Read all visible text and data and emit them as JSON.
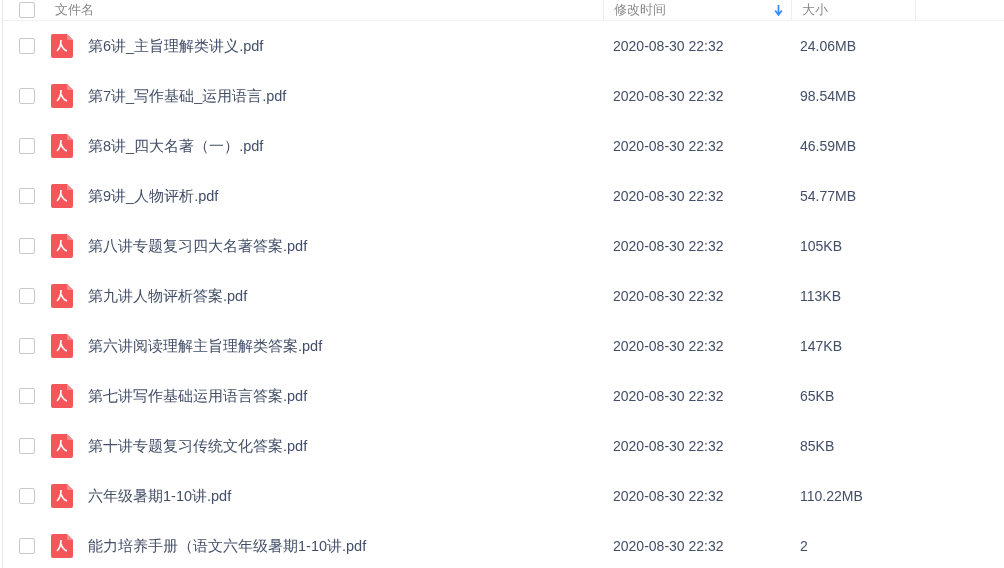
{
  "table": {
    "select_all_checked": false,
    "columns": [
      {
        "label": "文件名"
      },
      {
        "label": "修改时间",
        "sorted": true
      },
      {
        "label": "大小"
      }
    ],
    "rows": [
      {
        "name": "第6讲_主旨理解类讲义.pdf",
        "modified": "2020-08-30 22:32",
        "size": "24.06MB",
        "checked": false
      },
      {
        "name": "第7讲_写作基础_运用语言.pdf",
        "modified": "2020-08-30 22:32",
        "size": "98.54MB",
        "checked": false
      },
      {
        "name": "第8讲_四大名著（一）.pdf",
        "modified": "2020-08-30 22:32",
        "size": "46.59MB",
        "checked": false
      },
      {
        "name": "第9讲_人物评析.pdf",
        "modified": "2020-08-30 22:32",
        "size": "54.77MB",
        "checked": false
      },
      {
        "name": "第八讲专题复习四大名著答案.pdf",
        "modified": "2020-08-30 22:32",
        "size": "105KB",
        "checked": false
      },
      {
        "name": "第九讲人物评析答案.pdf",
        "modified": "2020-08-30 22:32",
        "size": "113KB",
        "checked": false
      },
      {
        "name": "第六讲阅读理解主旨理解类答案.pdf",
        "modified": "2020-08-30 22:32",
        "size": "147KB",
        "checked": false
      },
      {
        "name": "第七讲写作基础运用语言答案.pdf",
        "modified": "2020-08-30 22:32",
        "size": "65KB",
        "checked": false
      },
      {
        "name": "第十讲专题复习传统文化答案.pdf",
        "modified": "2020-08-30 22:32",
        "size": "85KB",
        "checked": false
      },
      {
        "name": "六年级暑期1-10讲.pdf",
        "modified": "2020-08-30 22:32",
        "size": "110.22MB",
        "checked": false
      },
      {
        "name": "能力培养手册（语文六年级暑期1-10讲.pdf",
        "modified": "2020-08-30 22:32",
        "size": "2",
        "checked": false
      }
    ]
  }
}
